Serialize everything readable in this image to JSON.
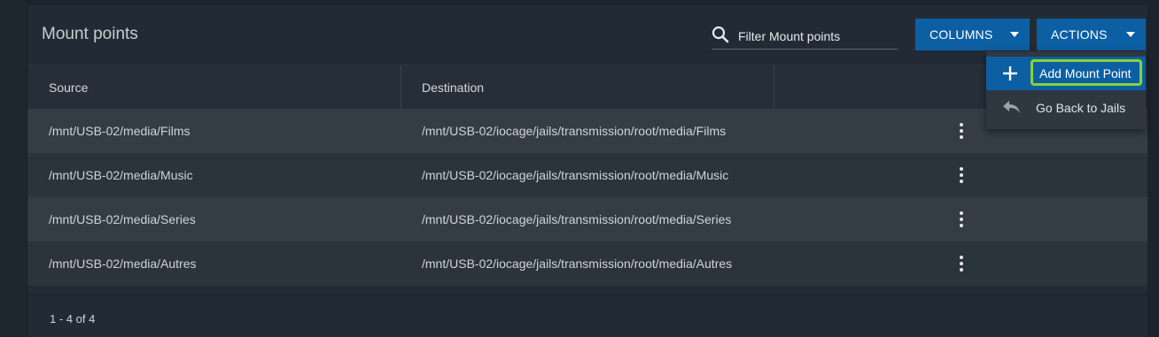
{
  "card": {
    "title": "Mount points",
    "filter": {
      "placeholder": "Filter Mount points",
      "icon": "search-icon"
    },
    "buttons": {
      "columns": "COLUMNS",
      "actions": "ACTIONS"
    }
  },
  "table": {
    "headers": {
      "source": "Source",
      "destination": "Destination"
    },
    "rows": [
      {
        "source": "/mnt/USB-02/media/Films",
        "destination": "/mnt/USB-02/iocage/jails/transmission/root/media/Films"
      },
      {
        "source": "/mnt/USB-02/media/Music",
        "destination": "/mnt/USB-02/iocage/jails/transmission/root/media/Music"
      },
      {
        "source": "/mnt/USB-02/media/Series",
        "destination": "/mnt/USB-02/iocage/jails/transmission/root/media/Series"
      },
      {
        "source": "/mnt/USB-02/media/Autres",
        "destination": "/mnt/USB-02/iocage/jails/transmission/root/media/Autres"
      }
    ],
    "pagination": "1 - 4 of 4"
  },
  "actions_menu": {
    "items": [
      {
        "label": "Add Mount Point",
        "icon": "plus-icon"
      },
      {
        "label": "Go Back to Jails",
        "icon": "reply-icon"
      }
    ]
  },
  "colors": {
    "accent": "#0d5fa3",
    "highlight": "#8ad13a",
    "background": "#1b232c"
  }
}
